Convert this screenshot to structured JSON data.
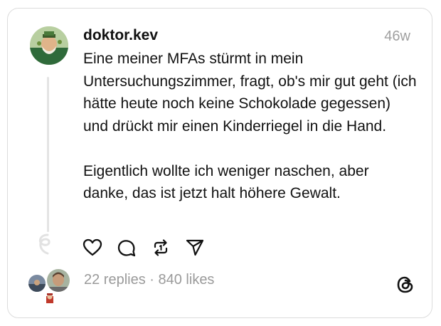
{
  "post": {
    "username": "doktor.kev",
    "timestamp": "46w",
    "text": "Eine meiner MFAs stürmt in mein Untersuchungszimmer, fragt, ob's mir gut geht (ich hätte heute noch keine Schokolade gegessen) und drückt mir einen Kinderriegel in die Hand.\n\nEigentlich wollte ich weniger naschen, aber danke, das ist jetzt halt höhere Gewalt.",
    "replies": "22 replies",
    "separator": " · ",
    "likes": "840 likes"
  },
  "actions": [
    {
      "icon": "heart-icon",
      "label": "Like"
    },
    {
      "icon": "comment-icon",
      "label": "Reply"
    },
    {
      "icon": "repost-icon",
      "label": "Repost"
    },
    {
      "icon": "share-icon",
      "label": "Share"
    }
  ],
  "colors": {
    "text": "#111111",
    "muted": "#a0a0a0",
    "border": "#dcdcdc",
    "thread_line": "#e4e4e4"
  }
}
